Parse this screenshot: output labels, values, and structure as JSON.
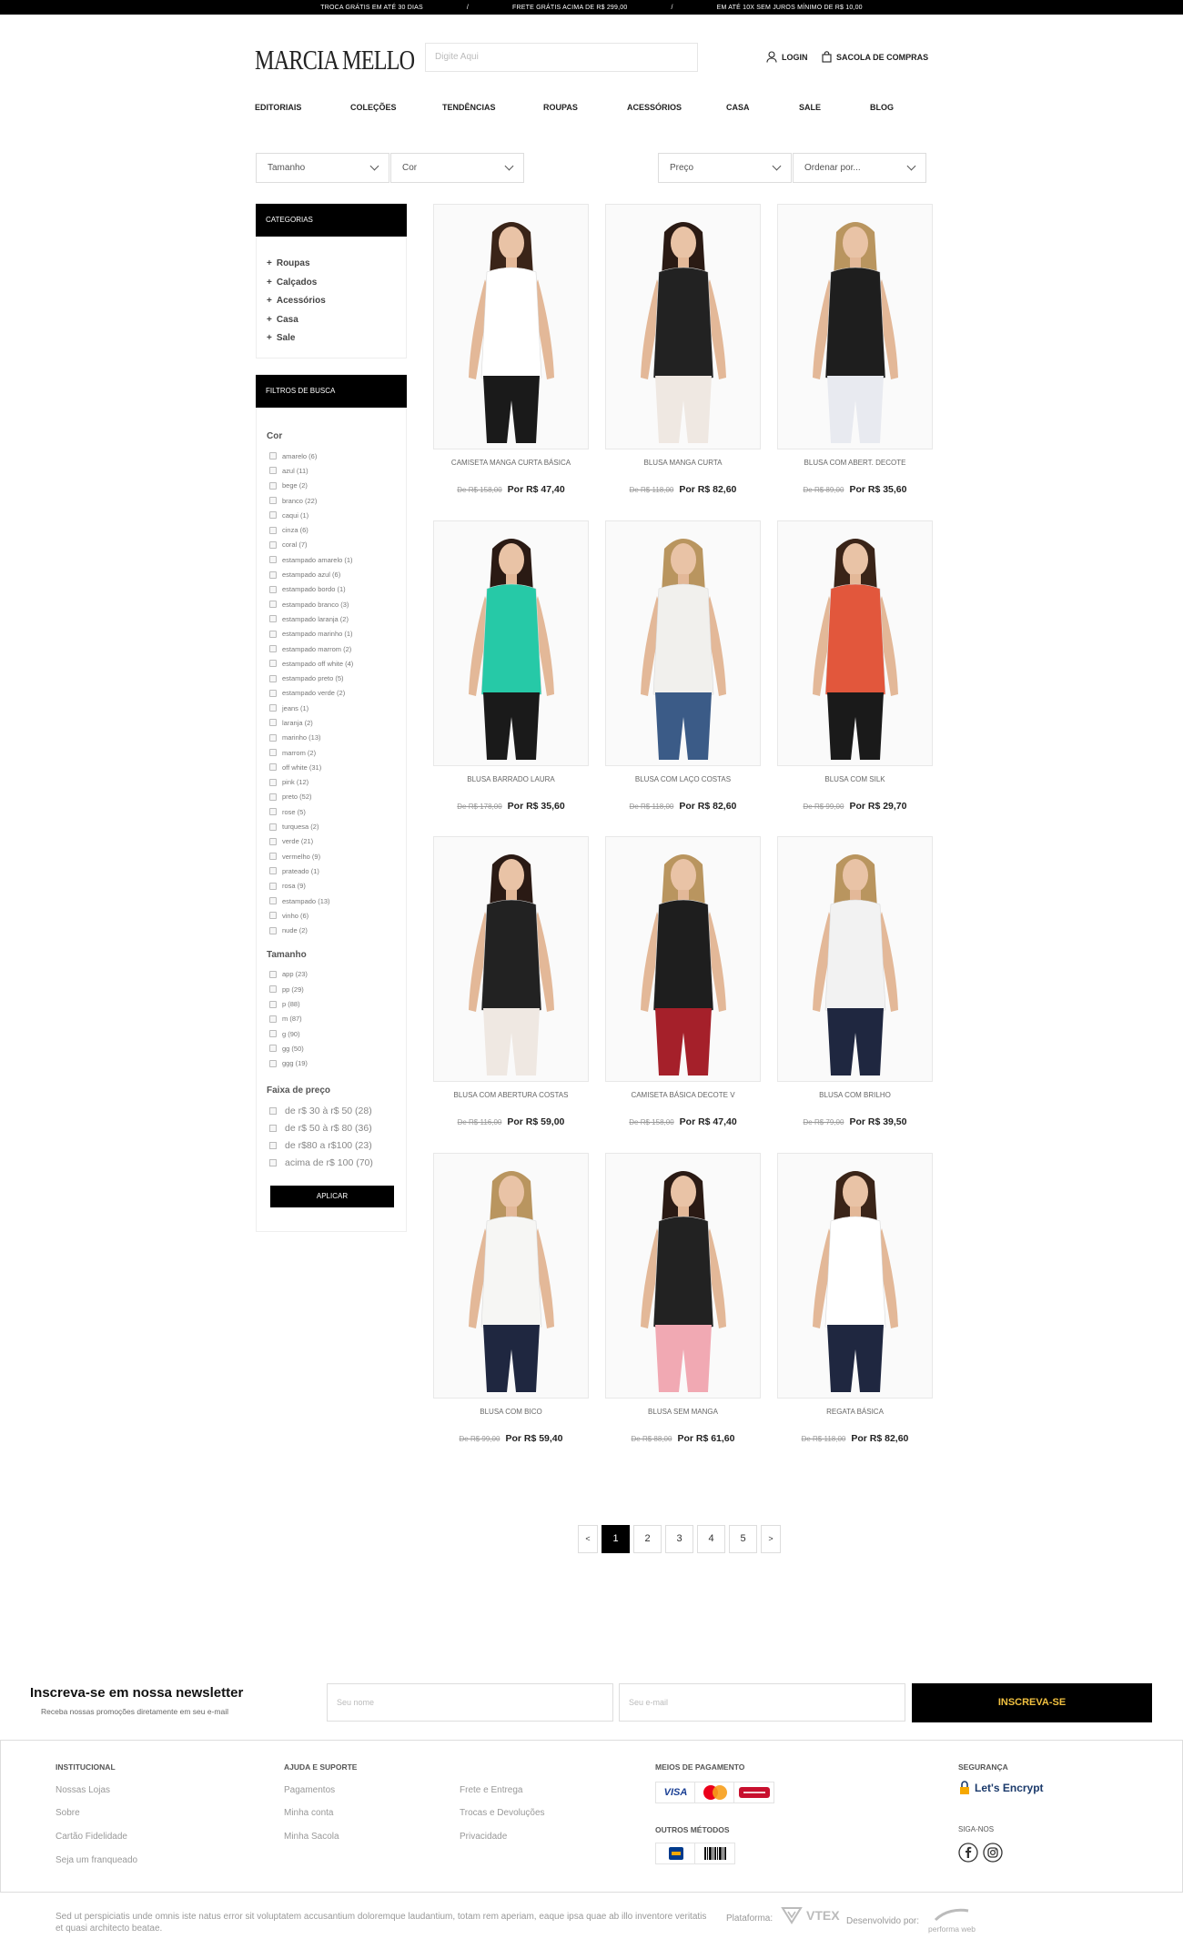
{
  "topbar": {
    "items": [
      "TROCA GRÁTIS EM ATÉ 30 DIAS",
      "/",
      "FRETE GRÁTIS ACIMA DE R$ 299,00",
      "/",
      "EM ATÉ 10X SEM JUROS MÍNIMO DE R$ 10,00"
    ]
  },
  "header": {
    "logo": "MARCIA MELLO",
    "search_placeholder": "Digite Aqui",
    "login": "LOGIN",
    "cart": "SACOLA DE COMPRAS"
  },
  "nav": [
    "EDITORIAIS",
    "COLEÇÕES",
    "TENDÊNCIAS",
    "ROUPAS",
    "ACESSÓRIOS",
    "CASA",
    "SALE",
    "BLOG"
  ],
  "filters_bar": {
    "size": "Tamanho",
    "color": "Cor",
    "price": "Preço",
    "order": "Ordenar por..."
  },
  "categories": {
    "title": "CATEGORIAS",
    "items": [
      "Roupas",
      "Calçados",
      "Acessórios",
      "Casa",
      "Sale"
    ]
  },
  "search_filters": {
    "title": "FILTROS DE BUSCA",
    "color_label": "Cor",
    "colors": [
      "amarelo (6)",
      "azul (11)",
      "bege (2)",
      "branco (22)",
      "caqui (1)",
      "cinza (6)",
      "coral (7)",
      "estampado amarelo (1)",
      "estampado azul (6)",
      "estampado bordo (1)",
      "estampado branco (3)",
      "estampado laranja (2)",
      "estampado marinho (1)",
      "estampado marrom (2)",
      "estampado off white (4)",
      "estampado preto (5)",
      "estampado verde (2)",
      "jeans (1)",
      "laranja (2)",
      "marinho (13)",
      "marrom (2)",
      "off white (31)",
      "pink (12)",
      "preto (52)",
      "rose (5)",
      "turquesa (2)",
      "verde (21)",
      "vermelho (9)",
      "prateado (1)",
      "rosa (9)",
      "estampado (13)",
      "vinho (6)",
      "nude (2)"
    ],
    "size_label": "Tamanho",
    "sizes": [
      "app (23)",
      "pp (29)",
      "p (88)",
      "m (87)",
      "g (90)",
      "gg (50)",
      "ggg (19)"
    ],
    "price_label": "Faixa de preço",
    "prices": [
      "de r$ 30 à r$ 50 (28)",
      "de r$ 50 à r$ 80 (36)",
      "de r$80 a r$100 (23)",
      "acima de r$ 100 (70)"
    ],
    "apply": "APLICAR"
  },
  "products": [
    {
      "name": "CAMISETA MANGA CURTA BÁSICA",
      "old": "De R$ 158,00",
      "new": "Por R$ 47,40",
      "top": "#ffffff",
      "bottom": "#1a1a1a",
      "hair": "#3a2418"
    },
    {
      "name": "BLUSA MANGA CURTA",
      "old": "De R$ 118,00",
      "new": "Por R$ 82,60",
      "top": "#222222",
      "bottom": "#efe8e2",
      "hair": "#2a1a14"
    },
    {
      "name": "BLUSA COM ABERT. DECOTE",
      "old": "De R$ 89,00",
      "new": "Por R$ 35,60",
      "top": "#1e1e1e",
      "bottom": "#e8eaf0",
      "hair": "#b9955f"
    },
    {
      "name": "BLUSA BARRADO LAURA",
      "old": "De R$ 178,00",
      "new": "Por R$ 35,60",
      "top": "#26c9a7",
      "bottom": "#1a1a1a",
      "hair": "#2a1a14"
    },
    {
      "name": "BLUSA COM LAÇO COSTAS",
      "old": "De R$ 118,00",
      "new": "Por R$ 82,60",
      "top": "#f1f0ed",
      "bottom": "#3b5b87",
      "hair": "#b9955f"
    },
    {
      "name": "BLUSA COM SILK",
      "old": "De R$ 99,00",
      "new": "Por R$ 29,70",
      "top": "#e2573c",
      "bottom": "#1a1a1a",
      "hair": "#3a2418"
    },
    {
      "name": "BLUSA COM ABERTURA COSTAS",
      "old": "De R$ 116,00",
      "new": "Por R$ 59,00",
      "top": "#222222",
      "bottom": "#efe8e2",
      "hair": "#2a1a14"
    },
    {
      "name": "CAMISETA BÁSICA DECOTE V",
      "old": "De R$ 158,00",
      "new": "Por R$ 47,40",
      "top": "#1e1e1e",
      "bottom": "#a5202a",
      "hair": "#b9955f"
    },
    {
      "name": "BLUSA COM BRILHO",
      "old": "De R$ 79,00",
      "new": "Por R$ 39,50",
      "top": "#f2f2f2",
      "bottom": "#1f2740",
      "hair": "#b9955f"
    },
    {
      "name": "BLUSA COM BICO",
      "old": "De R$ 99,00",
      "new": "Por R$ 59,40",
      "top": "#f6f6f4",
      "bottom": "#1f2740",
      "hair": "#b9955f"
    },
    {
      "name": "BLUSA SEM MANGA",
      "old": "De R$ 88,00",
      "new": "Por R$ 61,60",
      "top": "#222222",
      "bottom": "#f1a9b3",
      "hair": "#2a1a14"
    },
    {
      "name": "REGATA BÁSICA",
      "old": "De R$ 118,00",
      "new": "Por R$ 82,60",
      "top": "#ffffff",
      "bottom": "#1f2740",
      "hair": "#3a2418"
    }
  ],
  "pagination": {
    "prev": "<",
    "pages": [
      "1",
      "2",
      "3",
      "4",
      "5"
    ],
    "next": ">",
    "current": "1"
  },
  "newsletter": {
    "title": "Inscreva-se em nossa newsletter",
    "subtitle": "Receba nossas promoções diretamente em seu e-mail",
    "name_placeholder": "Seu nome",
    "email_placeholder": "Seu e-mail",
    "button": "INSCREVA-SE"
  },
  "footer": {
    "institucional": {
      "title": "INSTITUCIONAL",
      "links": [
        "Nossas Lojas",
        "Sobre",
        "Cartão Fidelidade",
        "Seja um franqueado"
      ]
    },
    "ajuda": {
      "title": "AJUDA E SUPORTE",
      "col1": [
        "Pagamentos",
        "Minha conta",
        "Minha Sacola"
      ],
      "col2": [
        "Frete e Entrega",
        "Trocas e Devoluções",
        "Privacidade"
      ]
    },
    "pagamento": {
      "title": "MEIOS DE PAGAMENTO",
      "cards": [
        "VISA",
        "MasterCard",
        "Hipercard"
      ],
      "other_title": "OUTROS MÉTODOS"
    },
    "seguranca": {
      "title": "SEGURANÇA",
      "badge": "Let's Encrypt",
      "social_title": "SIGA-NOS"
    },
    "copy": "Sed ut perspiciatis unde omnis iste natus error sit voluptatem accusantium doloremque laudantium, totam rem aperiam, eaque ipsa quae ab illo inventore veritatis et quasi architecto beatae.",
    "platform": "Plataforma:",
    "platform_name": "VTEX",
    "dev": "Desenvolvido por:",
    "dev_name": "performa web"
  }
}
